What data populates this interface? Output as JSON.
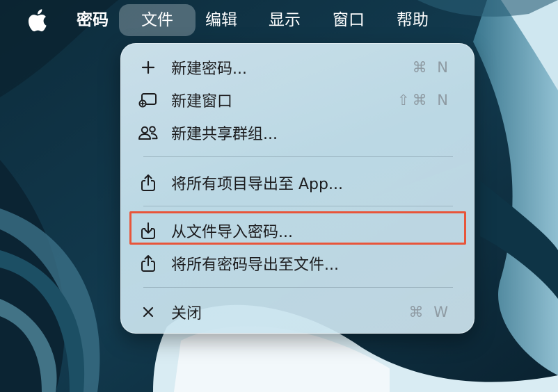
{
  "menubar": {
    "apple_icon": "apple-logo-icon",
    "items": [
      "密码",
      "文件",
      "编辑",
      "显示",
      "窗口",
      "帮助"
    ],
    "active_index": 1
  },
  "file_menu": {
    "items": [
      {
        "label": "新建密码...",
        "icon": "plus-icon",
        "shortcut": "⌘ N"
      },
      {
        "label": "新建窗口",
        "icon": "new-window-icon",
        "shortcut": "⇧⌘ N"
      },
      {
        "label": "新建共享群组...",
        "icon": "people-icon",
        "shortcut": ""
      },
      {
        "label": "将所有项目导出至 App...",
        "icon": "share-icon",
        "shortcut": ""
      },
      {
        "label": "从文件导入密码...",
        "icon": "import-icon",
        "shortcut": ""
      },
      {
        "label": "将所有密码导出至文件...",
        "icon": "share-icon",
        "shortcut": ""
      },
      {
        "label": "关闭",
        "icon": "close-icon",
        "shortcut": "⌘ W"
      }
    ]
  },
  "annotation": {
    "highlight_color": "#e8553a",
    "highlighted_item_index": 4
  }
}
